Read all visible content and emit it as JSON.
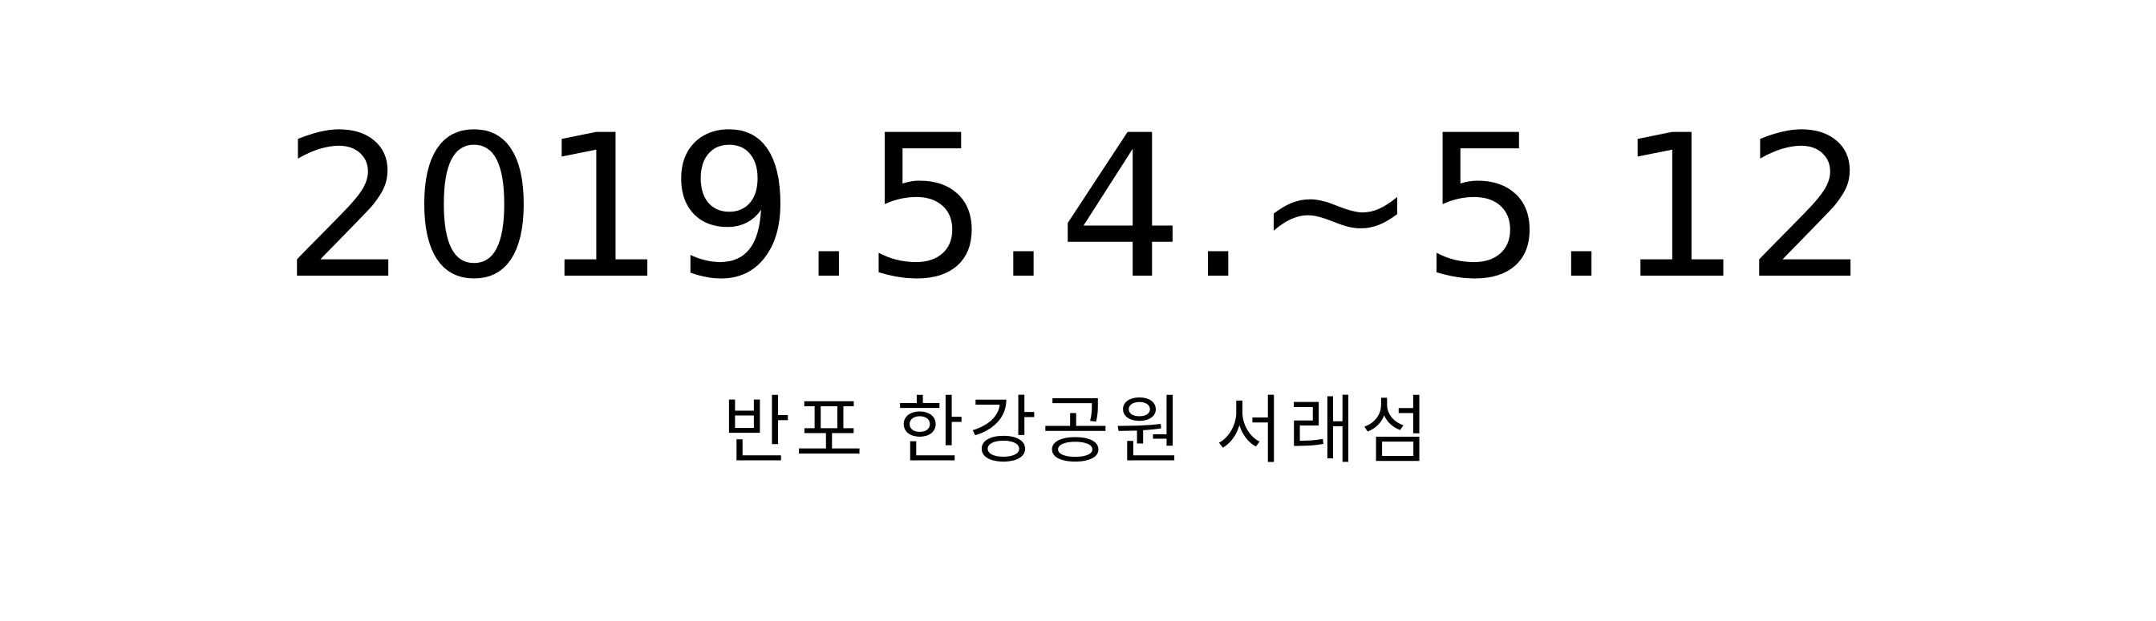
{
  "event": {
    "date_range": "2019.5.4.~5.12",
    "venue": "반포 한강공원 서래섬"
  }
}
